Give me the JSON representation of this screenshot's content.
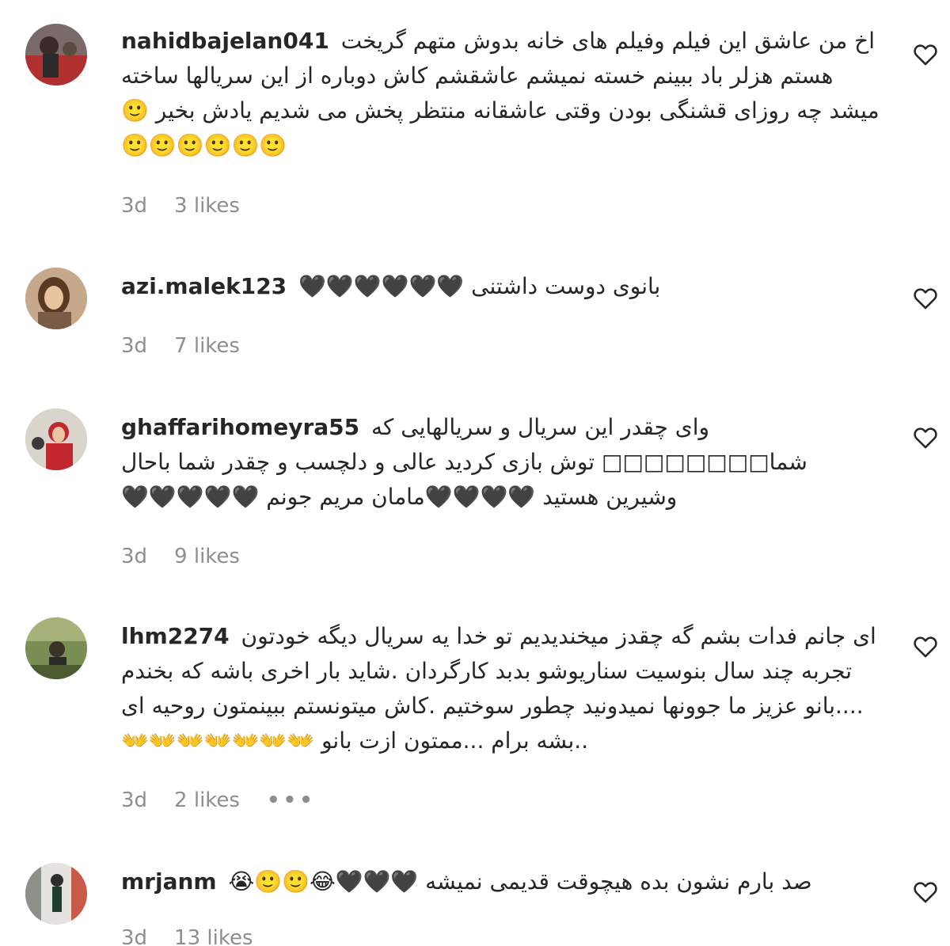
{
  "comments": [
    {
      "username": "nahidbajelan041",
      "text": "اخ من عاشق این فیلم وفیلم های خانه بدوش متهم گریخت هستم هزلر باد ببینم خسته نمیشم عاشقشم کاش دوباره از این سریالها ساخته میشد چه روزای قشنگی بودن وقتی عاشقانه منتظر پخش می شدیم یادش بخیر 🙂🙂🙂🙂🙂🙂🙂",
      "time": "3d",
      "likes": "3 likes",
      "more": ""
    },
    {
      "username": "azi.malek123",
      "text": "بانوی دوست داشتنی 🖤🖤🖤🖤🖤🖤",
      "time": "3d",
      "likes": "7 likes",
      "more": ""
    },
    {
      "username": "ghaffarihomeyra55",
      "text": "وای چقدر این سریال و سریالهایی که شما□□□□□□□□ توش بازی کردید عالی و دلچسب و چقدر شما باحال وشیرین هستید 🖤🖤🖤🖤مامان مریم جونم 🖤🖤🖤🖤🖤",
      "time": "3d",
      "likes": "9 likes",
      "more": ""
    },
    {
      "username": "lhm2274",
      "text": "ای جانم فدات بشم گه چقدز میخندیدیم تو خدا یه سریال دیگه خودتون تجربه چند سال بنوسیت سناریوشو بدبد کارگردان .شاید بار اخری باشه که بخندم ....بانو عزیز ما جوونها نمیدونید چطور سوختیم .کاش میتونستم ببینمتون روحیه ای ..بشه برام ...ممتون ازت بانو 👐👐👐👐👐👐👐",
      "time": "3d",
      "likes": "2 likes",
      "more": "•••"
    },
    {
      "username": "mrjanm",
      "text": "صد بارم نشون بده هیچوقت قدیمی نمیشه 🖤🖤🖤😂🙂🙂😭",
      "time": "3d",
      "likes": "13 likes",
      "more": ""
    }
  ]
}
